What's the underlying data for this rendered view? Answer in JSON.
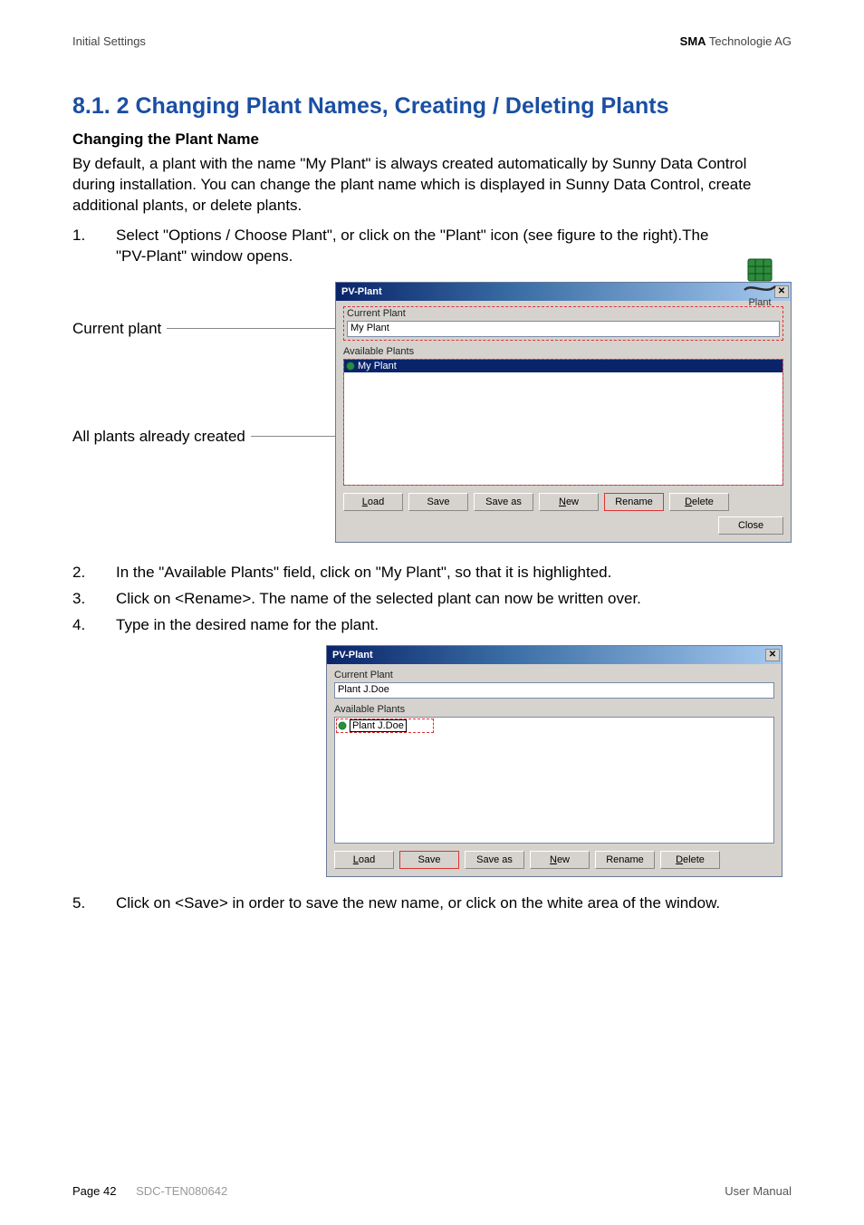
{
  "header": {
    "left": "Initial Settings",
    "right_bold": "SMA",
    "right_rest": " Technologie AG"
  },
  "title": "8.1. 2 Changing Plant Names, Creating / Deleting Plants",
  "subtitle": "Changing the Plant Name",
  "intro": "By default, a plant with the name \"My Plant\" is always created automatically by Sunny Data Control during installation. You can change the plant name which is displayed in Sunny Data Control, create additional plants, or delete plants.",
  "steps": {
    "s1": "Select \"Options / Choose Plant\", or click on the \"Plant\" icon (see figure to the right).The \"PV-Plant\" window opens.",
    "s2": "In the \"Available Plants\" field, click on \"My Plant\", so that it is highlighted.",
    "s3": "Click on <Rename>. The name of the selected plant can now be written over.",
    "s4": "Type in the desired name for the plant.",
    "s5": "Click on <Save> in order to save the new name, or click on the white area of the window."
  },
  "plant_icon_caption": "Plant",
  "callouts": {
    "current": "Current plant",
    "all": "All plants already created"
  },
  "win1": {
    "title": "PV-Plant",
    "grp_current": "Current Plant",
    "current_value": "My Plant",
    "grp_available": "Available Plants",
    "item0": "My Plant",
    "buttons": {
      "load": "Load",
      "save": "Save",
      "saveas": "Save as",
      "new": "New",
      "rename": "Rename",
      "delete": "Delete",
      "close": "Close"
    }
  },
  "win2": {
    "title": "PV-Plant",
    "grp_current": "Current Plant",
    "current_value": "Plant J.Doe",
    "grp_available": "Available Plants",
    "item0": "Plant J.Doe",
    "buttons": {
      "load": "Load",
      "save": "Save",
      "saveas": "Save as",
      "new": "New",
      "rename": "Rename",
      "delete": "Delete"
    }
  },
  "footer": {
    "page": "Page 42",
    "code": "SDC-TEN080642",
    "right": "User Manual"
  }
}
